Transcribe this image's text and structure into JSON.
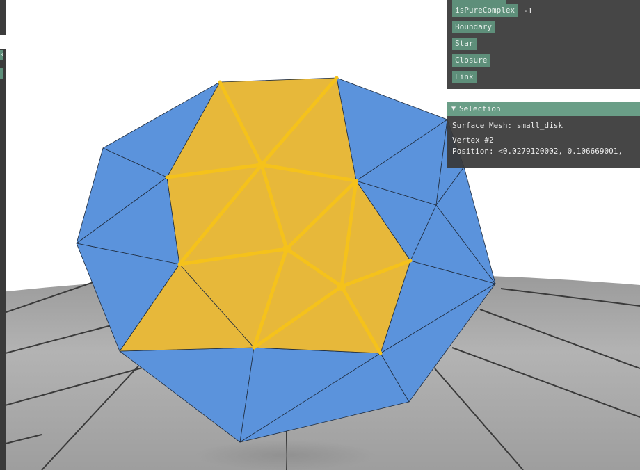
{
  "ops_panel": {
    "buttons": [
      {
        "label": "isPureComplex",
        "value": "-1"
      },
      {
        "label": "Boundary"
      },
      {
        "label": "Star"
      },
      {
        "label": "Closure"
      },
      {
        "label": "Link"
      }
    ]
  },
  "selection": {
    "header_icon": "triangle-down-icon",
    "header_glyph": "▼",
    "header_title": "Selection",
    "mesh_line": "Surface Mesh: small_disk",
    "vertex_line": "Vertex #2",
    "position_line": "Position: <0.0279120002, 0.106669001,"
  },
  "colors": {
    "mesh_face_blue": "#5b93dc",
    "selected_face_yellow": "#e7b83a",
    "selected_edge_yellow": "#f5c21b",
    "panel_bg": "#383838",
    "button_green": "#5e8f7a",
    "header_green": "#6a9e87"
  },
  "left_stub": {
    "label": "k"
  }
}
